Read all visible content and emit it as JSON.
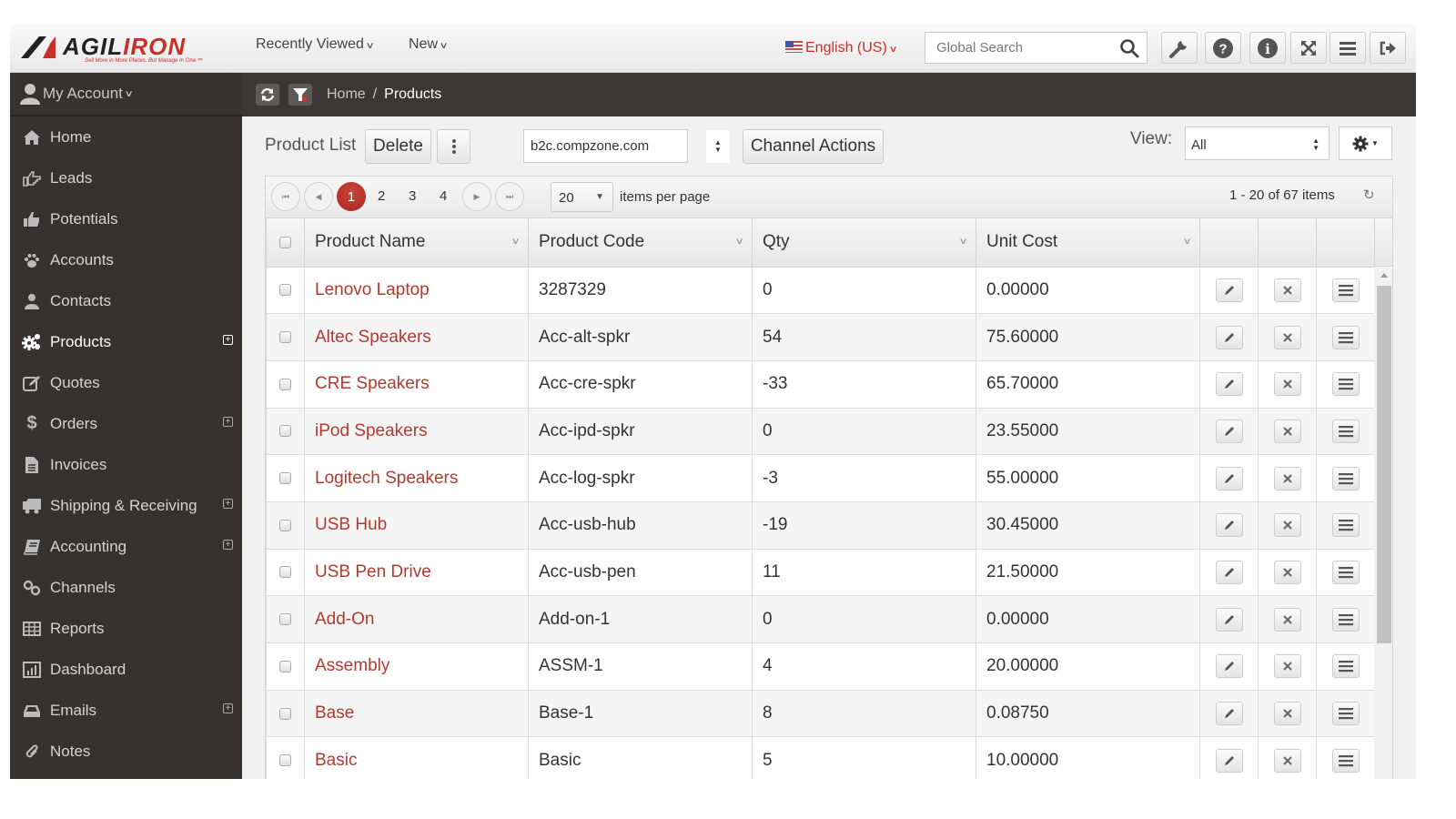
{
  "header": {
    "logo_text_dark": "AGIL",
    "logo_text_red": "IRON",
    "logo_tagline": "Sell More in More Places. But Manage In One.™",
    "recently_viewed": "Recently Viewed",
    "new": "New",
    "language": "English (US)",
    "search_placeholder": "Global Search",
    "tool_buttons": [
      "wrench-icon",
      "help-icon",
      "info-icon",
      "fullscreen-icon",
      "menu-icon",
      "logout-icon"
    ]
  },
  "sidebar": {
    "account_label": "My Account",
    "items": [
      {
        "label": "Home",
        "icon": "home-icon",
        "expandable": false,
        "active": false
      },
      {
        "label": "Leads",
        "icon": "hand-pointer-icon",
        "expandable": false,
        "active": false
      },
      {
        "label": "Potentials",
        "icon": "thumbs-up-icon",
        "expandable": false,
        "active": false
      },
      {
        "label": "Accounts",
        "icon": "paw-icon",
        "expandable": false,
        "active": false
      },
      {
        "label": "Contacts",
        "icon": "user-icon",
        "expandable": false,
        "active": false
      },
      {
        "label": "Products",
        "icon": "cogs-icon",
        "expandable": true,
        "active": true
      },
      {
        "label": "Quotes",
        "icon": "edit-icon",
        "expandable": false,
        "active": false
      },
      {
        "label": "Orders",
        "icon": "dollar-icon",
        "expandable": true,
        "active": false
      },
      {
        "label": "Invoices",
        "icon": "file-icon",
        "expandable": false,
        "active": false
      },
      {
        "label": "Shipping & Receiving",
        "icon": "truck-icon",
        "expandable": true,
        "active": false
      },
      {
        "label": "Accounting",
        "icon": "book-icon",
        "expandable": true,
        "active": false
      },
      {
        "label": "Channels",
        "icon": "link-icon",
        "expandable": false,
        "active": false
      },
      {
        "label": "Reports",
        "icon": "table-icon",
        "expandable": false,
        "active": false
      },
      {
        "label": "Dashboard",
        "icon": "bar-chart-icon",
        "expandable": false,
        "active": false
      },
      {
        "label": "Emails",
        "icon": "inbox-icon",
        "expandable": true,
        "active": false
      },
      {
        "label": "Notes",
        "icon": "paperclip-icon",
        "expandable": false,
        "active": false
      }
    ]
  },
  "breadcrumb": {
    "home": "Home",
    "separator": "/",
    "current": "Products"
  },
  "toolbar": {
    "title": "Product List",
    "delete_label": "Delete",
    "channel_value": "b2c.compzone.com",
    "channel_actions_label": "Channel Actions",
    "view_label": "View:",
    "view_value": "All"
  },
  "pager": {
    "pages": [
      "1",
      "2",
      "3",
      "4"
    ],
    "current_page": "1",
    "per_page": "20",
    "per_page_label": "items per page",
    "count_text": "1 - 20 of 67 items"
  },
  "table": {
    "columns": [
      "Product Name",
      "Product Code",
      "Qty",
      "Unit Cost"
    ],
    "rows": [
      {
        "name": "Lenovo Laptop",
        "code": "3287329",
        "qty": "0",
        "cost": "0.00000"
      },
      {
        "name": "Altec Speakers",
        "code": "Acc-alt-spkr",
        "qty": "54",
        "cost": "75.60000"
      },
      {
        "name": "CRE Speakers",
        "code": "Acc-cre-spkr",
        "qty": "-33",
        "cost": "65.70000"
      },
      {
        "name": "iPod Speakers",
        "code": "Acc-ipd-spkr",
        "qty": "0",
        "cost": "23.55000"
      },
      {
        "name": "Logitech Speakers",
        "code": "Acc-log-spkr",
        "qty": "-3",
        "cost": "55.00000"
      },
      {
        "name": "USB Hub",
        "code": "Acc-usb-hub",
        "qty": "-19",
        "cost": "30.45000"
      },
      {
        "name": "USB Pen Drive",
        "code": "Acc-usb-pen",
        "qty": "11",
        "cost": "21.50000"
      },
      {
        "name": "Add-On",
        "code": "Add-on-1",
        "qty": "0",
        "cost": "0.00000"
      },
      {
        "name": "Assembly",
        "code": "ASSM-1",
        "qty": "4",
        "cost": "20.00000"
      },
      {
        "name": "Base",
        "code": "Base-1",
        "qty": "8",
        "cost": "0.08750"
      },
      {
        "name": "Basic",
        "code": "Basic",
        "qty": "5",
        "cost": "10.00000"
      }
    ]
  },
  "colors": {
    "brand_red": "#c8302a",
    "link_red": "#b33a2e",
    "sidebar_bg": "#363230",
    "active_page": "#b5332a"
  }
}
